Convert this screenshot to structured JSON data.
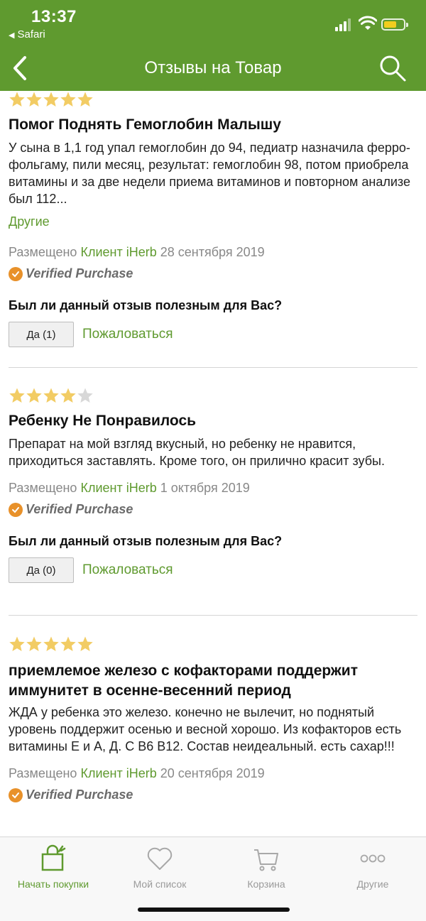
{
  "status_bar": {
    "time": "13:37",
    "back_app": "Safari"
  },
  "nav": {
    "title": "Отзывы на Товар"
  },
  "colors": {
    "brand_green": "#5f9a2f",
    "star_gold": "#f2cc64",
    "star_gray": "#d8d8d8",
    "verified_orange": "#e8912a"
  },
  "reviews": [
    {
      "rating": 5,
      "title": "Помог Поднять Гемоглобин Малышу",
      "body": "У сына в 1,1 год упал гемоглобин до 94, педиатр назначила ферро-фольгаму, пили месяц, результат: гемоглобин 98, потом приобрела витамины и за две недели приема витаминов и повторном анализе был 112...",
      "more_link": "Другие",
      "posted_prefix": "Размещено",
      "author": "Клиент iHerb",
      "date": "28 сентября 2019",
      "verified": "Verified Purchase",
      "helpful_question": "Был ли данный отзыв полезным для Вас?",
      "yes_button": "Да (1)",
      "report_link": "Пожаловаться"
    },
    {
      "rating": 4,
      "title": "Ребенку Не Понравилось",
      "body": "Препарат на мой взгляд вкусный, но ребенку не нравится, приходиться заставлять. Кроме того, он прилично красит зубы.",
      "posted_prefix": "Размещено",
      "author": "Клиент iHerb",
      "date": "1 октября 2019",
      "verified": "Verified Purchase",
      "helpful_question": "Был ли данный отзыв полезным для Вас?",
      "yes_button": "Да (0)",
      "report_link": "Пожаловаться"
    },
    {
      "rating": 5,
      "title": "приемлемое железо с кофакторами поддержит иммунитет в осенне-весенний период",
      "body": "ЖДА у ребенка это железо. конечно не вылечит, но поднятый уровень поддержит осенью и весной хорошо. Из кофакторов есть витамины Е и А, Д. С В6 В12. Состав неидеальный. есть сахар!!!",
      "posted_prefix": "Размещено",
      "author": "Клиент iHerb",
      "date": "20 сентября 2019",
      "verified": "Verified Purchase"
    }
  ],
  "tabbar": {
    "items": [
      {
        "label": "Начать покупки",
        "icon": "shopping-bag-icon",
        "active": true
      },
      {
        "label": "Мой список",
        "icon": "heart-icon",
        "active": false
      },
      {
        "label": "Корзина",
        "icon": "cart-icon",
        "active": false
      },
      {
        "label": "Другие",
        "icon": "more-icon",
        "active": false
      }
    ]
  }
}
